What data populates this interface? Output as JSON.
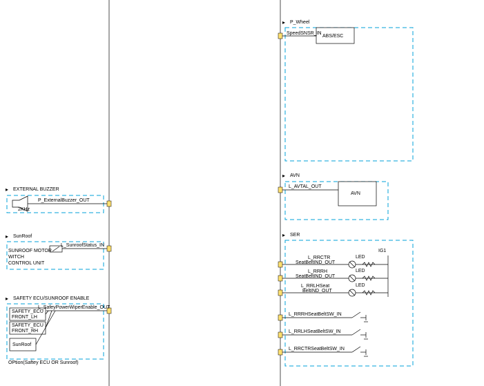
{
  "groups": {
    "p_wheel": {
      "label": "P_Wheel",
      "signal": "SpeedSNSR_IN",
      "block": "ABS/ESC"
    },
    "avn_grp": {
      "label": "AVN",
      "signal": "L_AVTAL_OUT",
      "block": "AVN"
    },
    "ext_buzzer": {
      "label": "EXTERNAL BUZZER",
      "signal": "P_ExternalBuzzer_OUT",
      "freq": "2KHz"
    },
    "sunroof": {
      "label": "SunRoof",
      "signal": "L_SunroofStatus_IN",
      "unit_l1": "SUNROOF MOTOR",
      "unit_l2": "WITCH",
      "unit_l3": "CONTROL UNIT"
    },
    "safety": {
      "label": "SAFETY ECU/SUNROOF ENABLE",
      "signal": "L_SafeyPowerWiperEnable_OUT",
      "row1": "SAFETY_ECU",
      "row2": "FRONT_LH",
      "row3": "SAFETY_ECU",
      "row4": "FRONT_RH",
      "row5": "SunRoof",
      "option": "OPtion(Saftey ECU OR Sunroof)"
    },
    "ser": {
      "label": "SER",
      "ig1": "IG1",
      "led": "LED",
      "s1a": "L_RRCTR",
      "s1b": "SeatBeltIND_OUT",
      "s2a": "L_RRRH",
      "s2b": "SeatBeltIND_OUT",
      "s3a": "L_RRLHSeat",
      "s3b": "BeltIND_OUT",
      "s4": "L_RRRHSeatBeltSW_IN",
      "s5": "L_RRLHSeatBeltSW_IN",
      "s6": "L_RRCTRSeatBeltSW_IN"
    }
  }
}
